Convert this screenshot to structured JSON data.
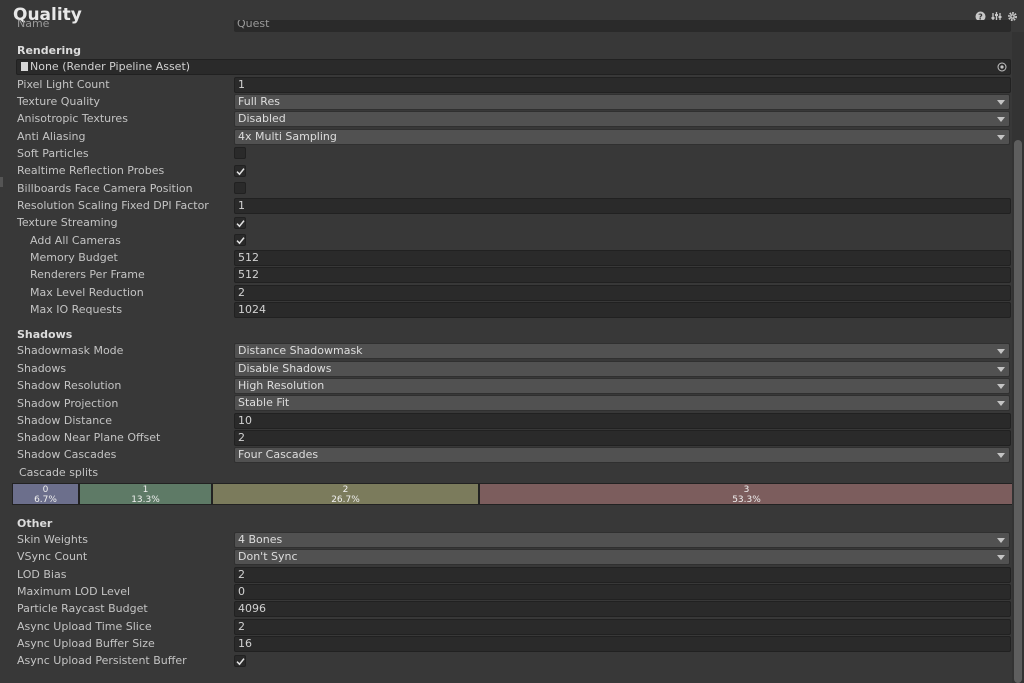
{
  "window": {
    "title": "Quality"
  },
  "name_row": {
    "label": "Name",
    "value": "Quest"
  },
  "rendering": {
    "header": "Rendering",
    "pipeline_asset": "None (Render Pipeline Asset)",
    "pixel_light_count": {
      "label": "Pixel Light Count",
      "value": "1"
    },
    "texture_quality": {
      "label": "Texture Quality",
      "value": "Full Res"
    },
    "anisotropic_textures": {
      "label": "Anisotropic Textures",
      "value": "Disabled"
    },
    "anti_aliasing": {
      "label": "Anti Aliasing",
      "value": "4x Multi Sampling"
    },
    "soft_particles": {
      "label": "Soft Particles",
      "checked": false
    },
    "realtime_reflection_probes": {
      "label": "Realtime Reflection Probes",
      "checked": true
    },
    "billboards_face_camera": {
      "label": "Billboards Face Camera Position",
      "checked": false
    },
    "resolution_scaling": {
      "label": "Resolution Scaling Fixed DPI Factor",
      "value": "1"
    },
    "texture_streaming": {
      "label": "Texture Streaming",
      "checked": true
    },
    "add_all_cameras": {
      "label": "Add All Cameras",
      "checked": true
    },
    "memory_budget": {
      "label": "Memory Budget",
      "value": "512"
    },
    "renderers_per_frame": {
      "label": "Renderers Per Frame",
      "value": "512"
    },
    "max_level_reduction": {
      "label": "Max Level Reduction",
      "value": "2"
    },
    "max_io_requests": {
      "label": "Max IO Requests",
      "value": "1024"
    }
  },
  "shadows": {
    "header": "Shadows",
    "shadowmask_mode": {
      "label": "Shadowmask Mode",
      "value": "Distance Shadowmask"
    },
    "shadows": {
      "label": "Shadows",
      "value": "Disable Shadows"
    },
    "shadow_resolution": {
      "label": "Shadow Resolution",
      "value": "High Resolution"
    },
    "shadow_projection": {
      "label": "Shadow Projection",
      "value": "Stable Fit"
    },
    "shadow_distance": {
      "label": "Shadow Distance",
      "value": "10"
    },
    "shadow_near_plane_offset": {
      "label": "Shadow Near Plane Offset",
      "value": "2"
    },
    "shadow_cascades": {
      "label": "Shadow Cascades",
      "value": "Four Cascades"
    },
    "cascade_splits_label": "Cascade splits",
    "cascade_splits": [
      {
        "index": "0",
        "percent": "6.7%",
        "fraction": 0.067,
        "color": "#6c6f8c"
      },
      {
        "index": "1",
        "percent": "13.3%",
        "fraction": 0.133,
        "color": "#5e7a66"
      },
      {
        "index": "2",
        "percent": "26.7%",
        "fraction": 0.267,
        "color": "#7b7b5c"
      },
      {
        "index": "3",
        "percent": "53.3%",
        "fraction": 0.533,
        "color": "#7c5d5d"
      }
    ]
  },
  "other": {
    "header": "Other",
    "skin_weights": {
      "label": "Skin Weights",
      "value": "4 Bones"
    },
    "vsync_count": {
      "label": "VSync Count",
      "value": "Don't Sync"
    },
    "lod_bias": {
      "label": "LOD Bias",
      "value": "2"
    },
    "maximum_lod_level": {
      "label": "Maximum LOD Level",
      "value": "0"
    },
    "particle_raycast_budget": {
      "label": "Particle Raycast Budget",
      "value": "4096"
    },
    "async_upload_time_slice": {
      "label": "Async Upload Time Slice",
      "value": "2"
    },
    "async_upload_buffer_size": {
      "label": "Async Upload Buffer Size",
      "value": "16"
    },
    "async_upload_persistent_buffer": {
      "label": "Async Upload Persistent Buffer",
      "checked": true
    }
  },
  "icons": {
    "help": "help-icon",
    "presets": "presets-icon",
    "settings": "gear-icon"
  }
}
